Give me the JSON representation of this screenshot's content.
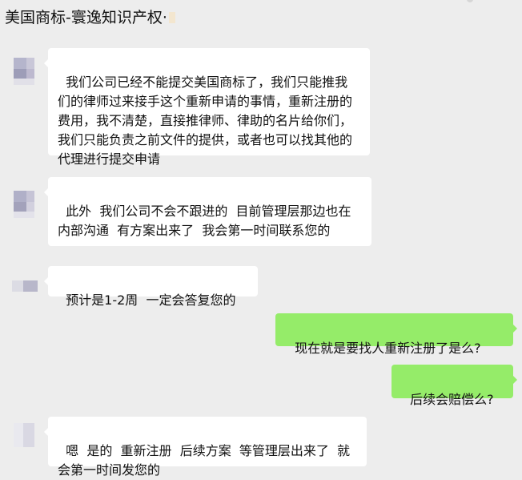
{
  "chat": {
    "title": "美国商标-寰逸知识产权·"
  },
  "messages": [
    {
      "side": "left",
      "text": "我们公司已经不能提交美国商标了，我们只能推我们的律师过来接手这个重新申请的事情，重新注册的费用，我不清楚，直接推律师、律助的名片给你们，我们只能负责之前文件的提供，或者也可以找其他的代理进行提交申请"
    },
    {
      "side": "left",
      "text": "此外  我们公司不会不跟进的  目前管理层那边也在内部沟通  有方案出来了  我会第一时间联系您的"
    },
    {
      "side": "left",
      "text": "预计是1-2周  一定会答复您的"
    },
    {
      "side": "right",
      "text": "现在就是要找人重新注册了是么?"
    },
    {
      "side": "right",
      "text": "后续会赔偿么?"
    },
    {
      "side": "left",
      "text": "嗯  是的  重新注册  后续方案  等管理层出来了  就会第一时间发您的"
    }
  ],
  "colors": {
    "background": "#ededed",
    "left_bubble": "#ffffff",
    "right_bubble": "#95ec69"
  }
}
